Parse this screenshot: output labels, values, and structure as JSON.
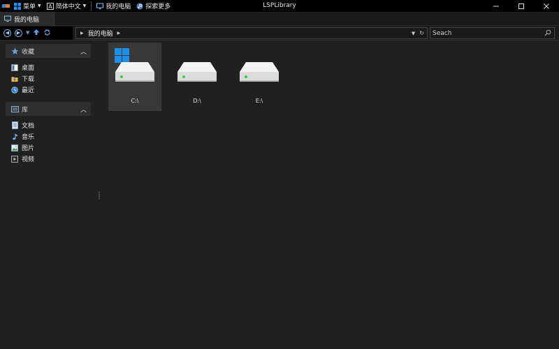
{
  "titlebar": {
    "menu_label": "菜单",
    "language_label": "简体中文",
    "computer_label": "我的电脑",
    "explore_label": "探索更多",
    "window_title": "LSPLibrary"
  },
  "tabs": [
    {
      "label": "我的电脑"
    }
  ],
  "navigation": {
    "breadcrumb": "我的电脑",
    "search_placeholder": "Seach"
  },
  "sidebar": {
    "favorites": {
      "header": "收藏",
      "items": [
        {
          "label": "桌面",
          "icon": "desktop-icon"
        },
        {
          "label": "下载",
          "icon": "downloads-folder-icon"
        },
        {
          "label": "最近",
          "icon": "clock-icon"
        }
      ]
    },
    "library": {
      "header": "库",
      "items": [
        {
          "label": "文档",
          "icon": "document-icon"
        },
        {
          "label": "音乐",
          "icon": "music-note-icon"
        },
        {
          "label": "图片",
          "icon": "picture-icon"
        },
        {
          "label": "视频",
          "icon": "video-icon"
        }
      ]
    }
  },
  "drives": [
    {
      "label": "C:\\",
      "selected": true,
      "system": true
    },
    {
      "label": "D:\\",
      "selected": false,
      "system": false
    },
    {
      "label": "E:\\",
      "selected": false,
      "system": false
    }
  ],
  "colors": {
    "accent": "#1e90e8",
    "led": "#35d135"
  }
}
